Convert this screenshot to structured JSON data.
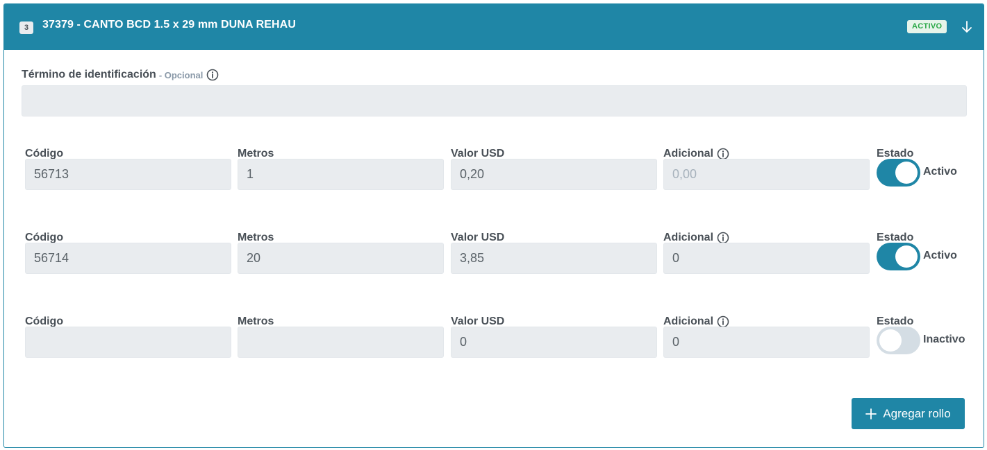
{
  "header": {
    "index": "3",
    "title": "37379 - CANTO BCD 1.5 x 29 mm DUNA REHAU",
    "status": "ACTIVO",
    "toggle_icon": "arrow-down-icon"
  },
  "identification": {
    "label": "Término de identificación",
    "optional": "- Opcional",
    "value": ""
  },
  "columns": {
    "codigo": "Código",
    "metros": "Metros",
    "valor": "Valor USD",
    "adicional": "Adicional",
    "estado": "Estado"
  },
  "rows": [
    {
      "codigo": "56713",
      "metros": "1",
      "valor": "0,20",
      "adicional": "",
      "adicional_placeholder": "0,00",
      "estado": "Activo",
      "active": true
    },
    {
      "codigo": "56714",
      "metros": "20",
      "valor": "3,85",
      "adicional": "0",
      "adicional_placeholder": "",
      "estado": "Activo",
      "active": true
    },
    {
      "codigo": "",
      "metros": "",
      "valor": "0",
      "adicional": "0",
      "adicional_placeholder": "",
      "estado": "Inactivo",
      "active": false
    }
  ],
  "actions": {
    "add_label": "Agregar rollo"
  },
  "colors": {
    "primary": "#1f86a6",
    "active_text": "#28a745",
    "input_bg": "#e9ecef"
  }
}
